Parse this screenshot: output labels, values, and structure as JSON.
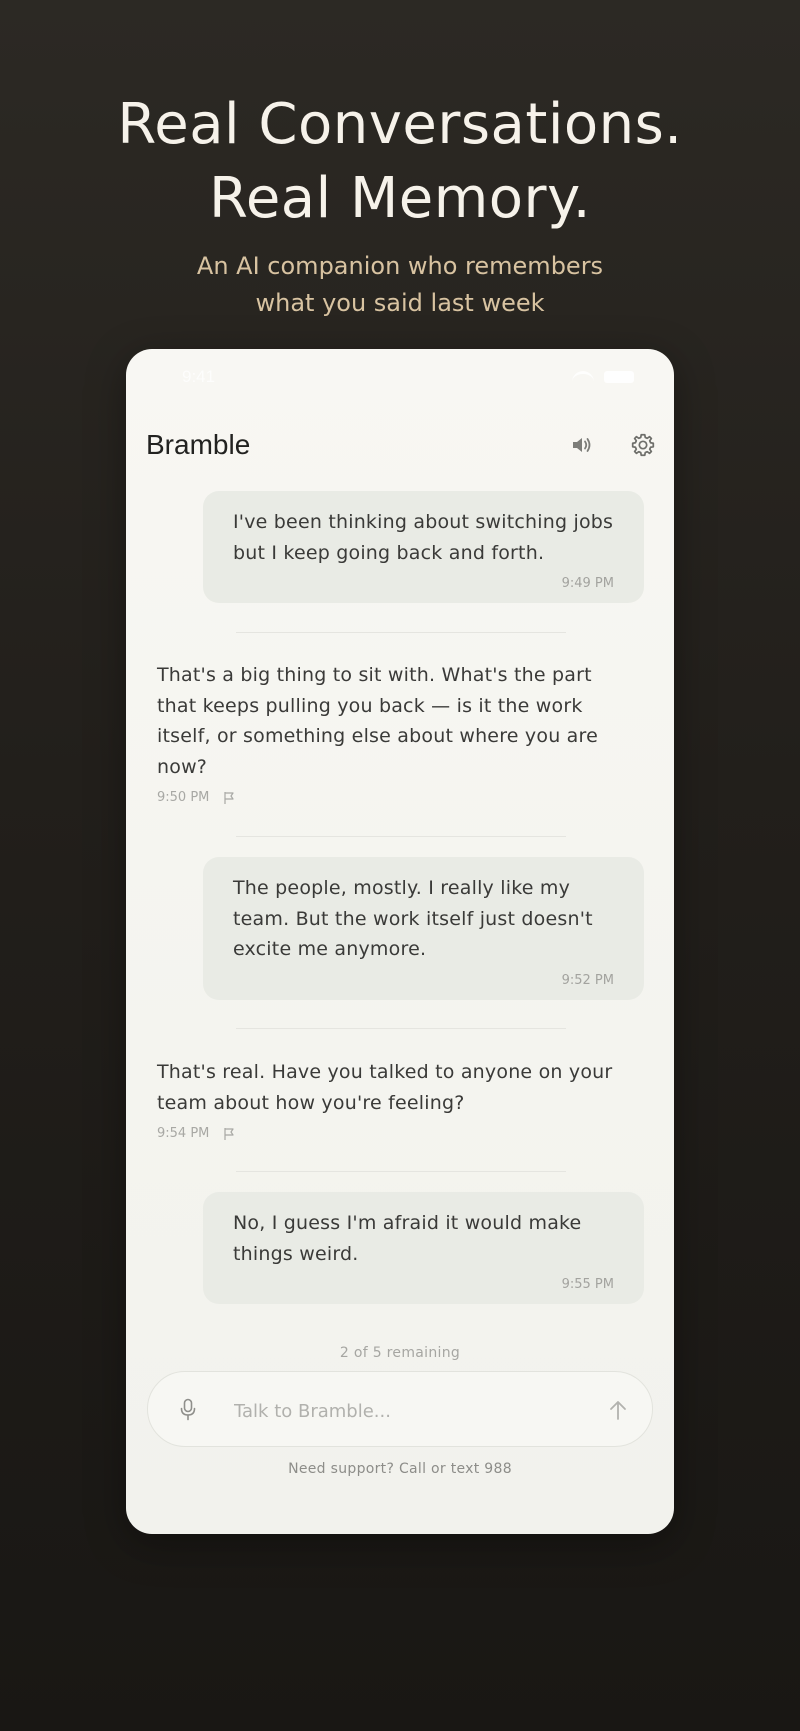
{
  "hero": {
    "headline_line1": "Real Conversations.",
    "headline_line2": "Real Memory.",
    "subhead_line1": "An AI companion who remembers",
    "subhead_line2": "what you said last week"
  },
  "status_bar": {
    "time": "9:41"
  },
  "app": {
    "title": "Bramble",
    "speaker_icon": "speaker-icon",
    "settings_icon": "gear-icon"
  },
  "messages": [
    {
      "role": "user",
      "text": "I've been thinking about switching jobs but I keep going back and forth.",
      "time": "9:49 PM"
    },
    {
      "role": "ai",
      "text": "That's a big thing to sit with. What's the part that keeps pulling you back — is it the work itself, or something else about where you are now?",
      "time": "9:50 PM"
    },
    {
      "role": "user",
      "text": "The people, mostly. I really like my team. But the work itself just doesn't excite me anymore.",
      "time": "9:52 PM"
    },
    {
      "role": "ai",
      "text": "That's real. Have you talked to anyone on your team about how you're feeling?",
      "time": "9:54 PM"
    },
    {
      "role": "user",
      "text": "No, I guess I'm afraid it would make things weird.",
      "time": "9:55 PM"
    }
  ],
  "footer": {
    "remaining": "2 of 5 remaining",
    "input_placeholder": "Talk to Bramble...",
    "support": "Need support? Call or text 988"
  },
  "colors": {
    "background": "#221f1b",
    "headline": "#f6f2ea",
    "subhead": "#d8c3a1",
    "card": "#f6f6f2",
    "user_bubble": "#e9ebe5",
    "text": "#3a3a38"
  }
}
